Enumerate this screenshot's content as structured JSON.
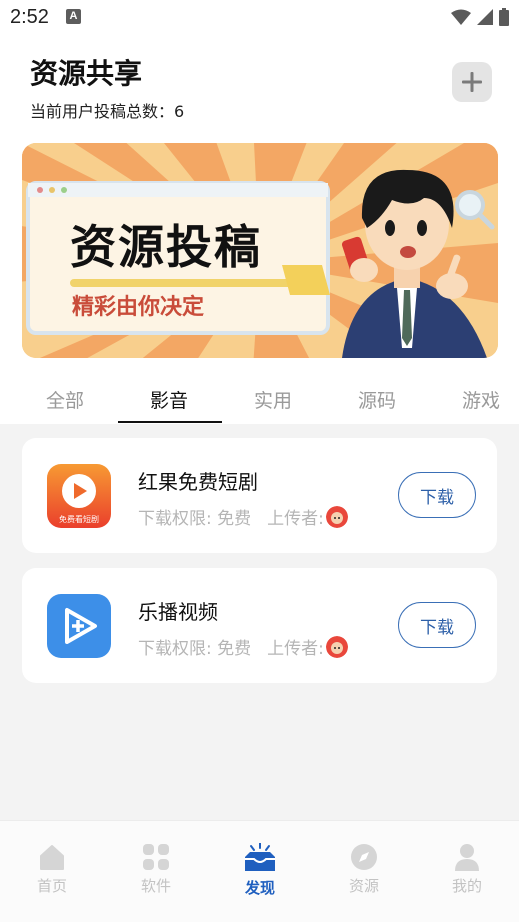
{
  "status_bar": {
    "time": "2:52",
    "a_icon": "A"
  },
  "header": {
    "title": "资源共享",
    "subtitle": "当前用户投稿总数：6",
    "add_icon": "plus-icon"
  },
  "banner": {
    "title": "资源投稿",
    "subtitle": "精彩由你决定"
  },
  "tabs": [
    {
      "label": "全部",
      "active": false
    },
    {
      "label": "影音",
      "active": true
    },
    {
      "label": "实用",
      "active": false
    },
    {
      "label": "源码",
      "active": false
    },
    {
      "label": "游戏",
      "active": false
    }
  ],
  "resources": [
    {
      "name": "红果免费短剧",
      "permission": "下载权限: 免费",
      "uploader_label": "上传者:",
      "button": "下载",
      "icon_text": "免费看短剧",
      "icon_color": "#ef5a2c"
    },
    {
      "name": "乐播视频",
      "permission": "下载权限: 免费",
      "uploader_label": "上传者:",
      "button": "下载",
      "icon_color": "#3d8fe8"
    }
  ],
  "bottom_nav": [
    {
      "label": "首页",
      "icon": "home-icon",
      "active": false
    },
    {
      "label": "软件",
      "icon": "grid-icon",
      "active": false
    },
    {
      "label": "发现",
      "icon": "inbox-icon",
      "active": true
    },
    {
      "label": "资源",
      "icon": "compass-icon",
      "active": false
    },
    {
      "label": "我的",
      "icon": "user-icon",
      "active": false
    }
  ]
}
